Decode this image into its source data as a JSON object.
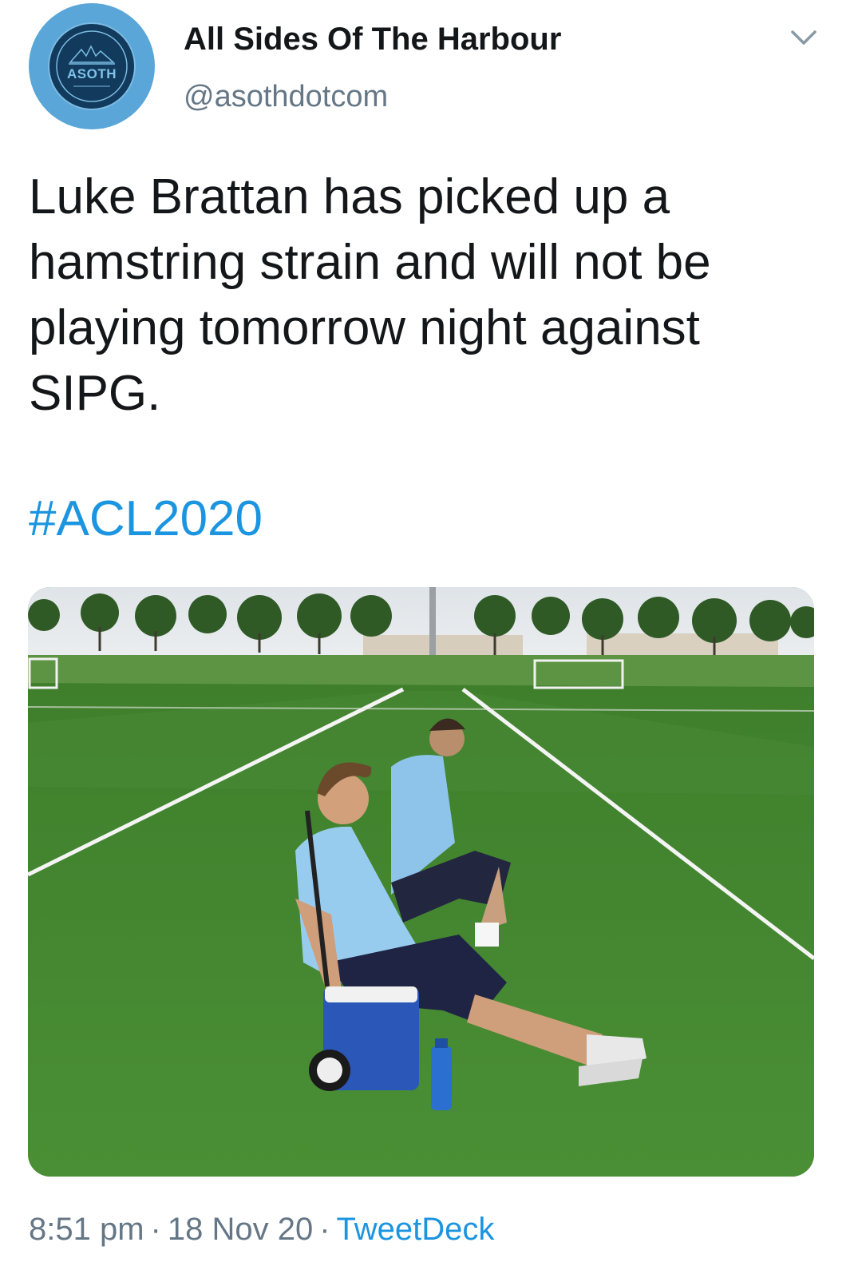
{
  "author": {
    "display_name": "All Sides Of The Harbour",
    "handle": "@asothdotcom",
    "avatar_logo": "ASOTH",
    "avatar_icon": "harbour-logo-icon"
  },
  "tweet": {
    "text": "Luke Brattan has picked up a hamstring strain and will not be playing tomorrow night against SIPG.",
    "hashtag": "#ACL2020",
    "media_alt": "photo"
  },
  "meta": {
    "time": "8:51 pm",
    "date": "18 Nov 20",
    "source": "TweetDeck",
    "separator": "·"
  },
  "icons": {
    "menu": "chevron-down-icon"
  },
  "colors": {
    "link": "#1b95e0",
    "secondary_text": "#657786",
    "avatar_ring": "#5aa6d8"
  }
}
